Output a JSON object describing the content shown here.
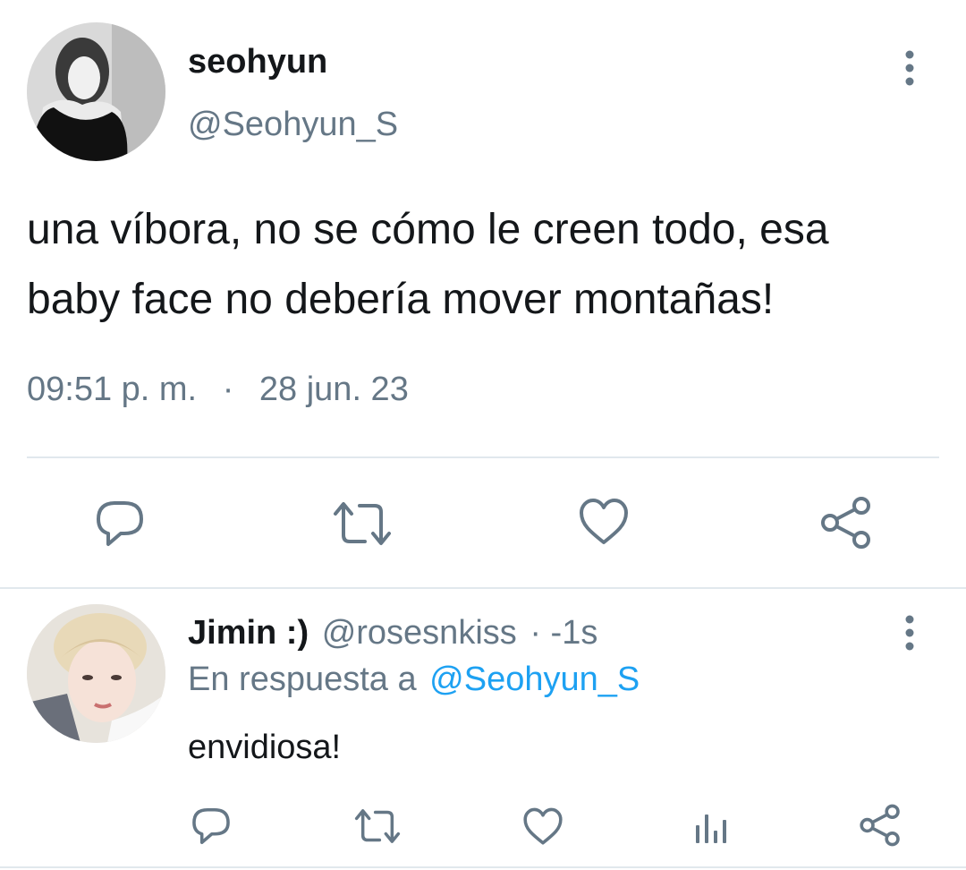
{
  "colors": {
    "text": "#14171a",
    "muted": "#657786",
    "link": "#1da1f2",
    "divider": "#e1e8ed",
    "icon": "#657786"
  },
  "tweet": {
    "display_name": "seohyun",
    "handle": "@Seohyun_S",
    "text": "una víbora, no se cómo le creen todo, esa baby face no debería mover montañas!",
    "time": "09:51 p. m.",
    "separator": "·",
    "date": "28 jun. 23",
    "actions": [
      "reply-icon",
      "retweet-icon",
      "like-icon",
      "share-icon"
    ]
  },
  "reply": {
    "display_name": "Jimin :)",
    "handle": "@rosesnkiss",
    "age": "· -1s",
    "in_reply_prefix": "En respuesta a",
    "in_reply_handle": "@Seohyun_S",
    "text": "envidiosa!",
    "actions": [
      "reply-icon",
      "retweet-icon",
      "like-icon",
      "analytics-icon",
      "share-icon"
    ]
  }
}
